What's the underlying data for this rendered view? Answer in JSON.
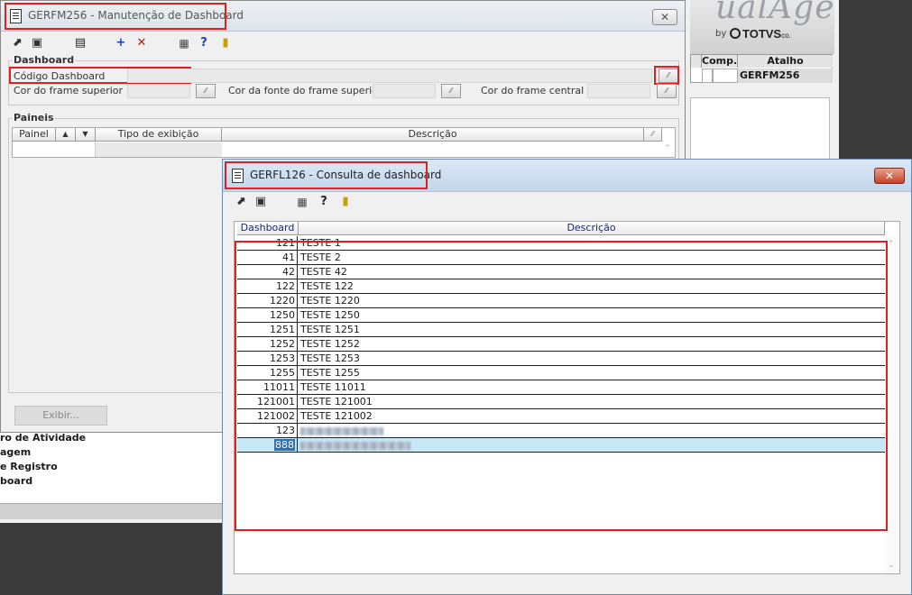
{
  "background_app": {
    "brand": "ualAge",
    "brand_by": "by",
    "brand_totvs": "TOTVS",
    "grid_headers": {
      "comp": "Comp.",
      "atalho": "Atalho"
    },
    "grid_row_atalho": "GERFM256",
    "list_items": [
      "ro de Atividade",
      "agem",
      "e Registro",
      "board"
    ]
  },
  "window1": {
    "title": "GERFM256 - Manutenção de Dashboard",
    "close_label": "✕",
    "group_dashboard": "Dashboard",
    "codigo_label": "Código Dashboard",
    "cor_frame_superior_label": "Cor do frame superior",
    "cor_fonte_label": "Cor da fonte do frame superior",
    "cor_frame_central_label": "Cor do frame central",
    "group_paineis": "Paineis",
    "columns": {
      "painel": "Painel",
      "up": "▲",
      "down": "▼",
      "tipo": "Tipo de exibição",
      "descricao": "Descrição"
    },
    "exibir_button": "Exibir..."
  },
  "window2": {
    "title": "GERFL126 - Consulta de dashboard",
    "close_label": "✕",
    "columns": {
      "dashboard": "Dashboard",
      "descricao": "Descrição"
    },
    "rows": [
      {
        "id": "121",
        "desc": "TESTE 1"
      },
      {
        "id": "41",
        "desc": "TESTE 2"
      },
      {
        "id": "42",
        "desc": "TESTE 42"
      },
      {
        "id": "122",
        "desc": "TESTE 122"
      },
      {
        "id": "1220",
        "desc": "TESTE 1220"
      },
      {
        "id": "1250",
        "desc": "TESTE 1250"
      },
      {
        "id": "1251",
        "desc": "TESTE 1251"
      },
      {
        "id": "1252",
        "desc": "TESTE 1252"
      },
      {
        "id": "1253",
        "desc": "TESTE 1253"
      },
      {
        "id": "1255",
        "desc": "TESTE 1255"
      },
      {
        "id": "11011",
        "desc": "TESTE 11011"
      },
      {
        "id": "121001",
        "desc": "TESTE 121001"
      },
      {
        "id": "121002",
        "desc": "TESTE 121002"
      },
      {
        "id": "123",
        "desc": ""
      },
      {
        "id": "888",
        "desc": ""
      }
    ]
  },
  "colors": {
    "highlight_red": "#e02020",
    "selected_row": "#c7e7f7",
    "selected_cell": "#2f6fbf"
  }
}
